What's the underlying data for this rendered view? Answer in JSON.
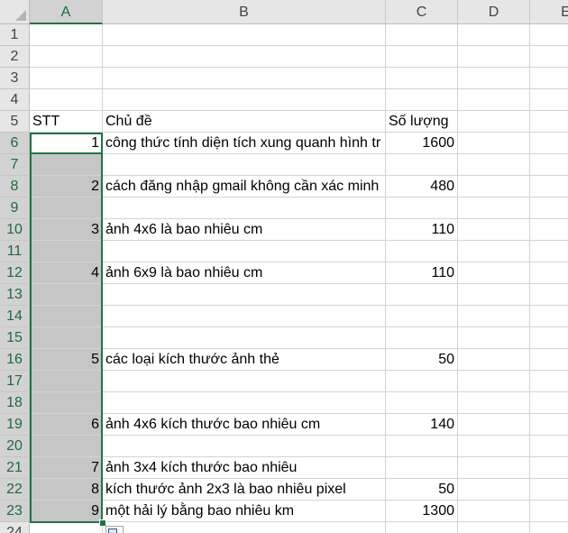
{
  "columns": [
    "A",
    "B",
    "C",
    "D",
    "E"
  ],
  "rows": [
    "1",
    "2",
    "3",
    "4",
    "5",
    "6",
    "7",
    "8",
    "9",
    "10",
    "11",
    "12",
    "13",
    "14",
    "15",
    "16",
    "17",
    "18",
    "19",
    "20",
    "21",
    "22",
    "23",
    "24"
  ],
  "selection": {
    "range": "A6:A23",
    "active_cell": "A6"
  },
  "cells": {
    "header": {
      "stt": "STT",
      "topic": "Chủ đề",
      "qty": "Số lượng"
    },
    "r6": {
      "stt": "1",
      "topic": "công thức tính diện tích xung quanh hình tr",
      "qty": "1600"
    },
    "r8": {
      "stt": "2",
      "topic": "cách đăng nhập gmail không cần xác minh",
      "qty": "480"
    },
    "r10": {
      "stt": "3",
      "topic": "ảnh 4x6 là bao nhiêu cm",
      "qty": "110"
    },
    "r12": {
      "stt": "4",
      "topic": "ảnh 6x9 là bao nhiêu cm",
      "qty": "110"
    },
    "r16": {
      "stt": "5",
      "topic": "các loại kích thước ảnh thẻ",
      "qty": "50"
    },
    "r19": {
      "stt": "6",
      "topic": "ảnh 4x6 kích thước bao nhiêu cm",
      "qty": "140"
    },
    "r21": {
      "stt": "7",
      "topic": "ảnh 3x4 kích thước bao nhiêu",
      "qty": ""
    },
    "r22": {
      "stt": "8",
      "topic": "kích thước ảnh 2x3 là bao nhiêu pixel",
      "qty": "50"
    },
    "r23": {
      "stt": "9",
      "topic": "một hải lý bằng bao nhiêu km",
      "qty": "1300"
    }
  },
  "colors": {
    "selection_border": "#217346",
    "selection_fill": "#c6c6c6",
    "header_bg": "#e6e6e6"
  },
  "icons": {
    "select_all": "select-all-triangle-icon",
    "quick_analysis": "quick-analysis-icon"
  }
}
